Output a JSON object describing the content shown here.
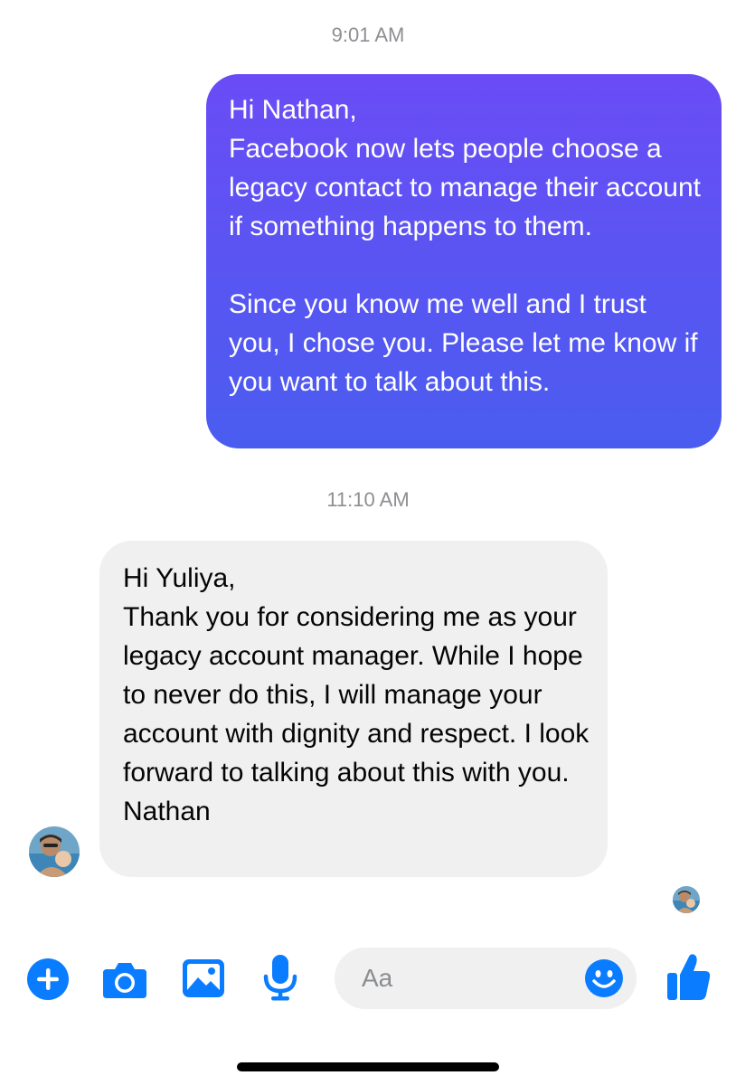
{
  "conversation": {
    "messages": [
      {
        "timestamp": "9:01 AM",
        "direction": "outgoing",
        "text": "Hi Nathan,\nFacebook now lets people choose a legacy contact to manage their account if something happens to them.\n\nSince you know me well and I trust you, I chose you. Please let me know if you want to talk about this."
      },
      {
        "timestamp": "11:10 AM",
        "direction": "incoming",
        "text": "Hi Yuliya,\nThank you for considering me as your legacy account manager. While I hope to never do this, I will manage your account with dignity and respect. I look forward to talking about this with you.\nNathan"
      }
    ]
  },
  "composer": {
    "placeholder": "Aa",
    "value": ""
  },
  "toolbar": {
    "icons": [
      "plus-icon",
      "camera-icon",
      "photo-icon",
      "microphone-icon",
      "emoji-icon",
      "thumbs-up-icon"
    ]
  },
  "colors": {
    "accent": "#0a7cff",
    "outgoing_bubble_top": "#6a4cf6",
    "outgoing_bubble_bottom": "#4a5cf0",
    "incoming_bubble": "#f0f0f0",
    "timestamp_text": "#8e8e93"
  }
}
